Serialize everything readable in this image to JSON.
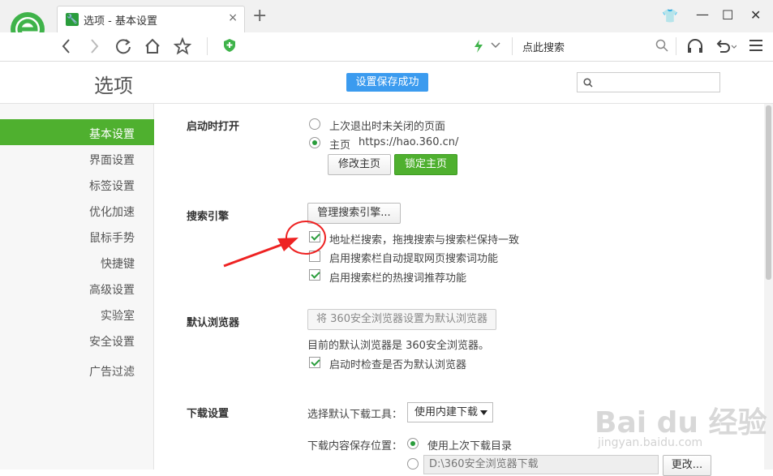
{
  "tab": {
    "title": "选项 - 基本设置",
    "close": "×",
    "new_tab": "+"
  },
  "window_controls": {
    "skin": "👕",
    "minimize": "—",
    "maximize": "☐",
    "close": "✕"
  },
  "address_bar": {
    "search_placeholder": "点此搜索"
  },
  "header": {
    "title": "选项",
    "toast": "设置保存成功"
  },
  "sidebar": {
    "items": [
      {
        "label": "基本设置"
      },
      {
        "label": "界面设置"
      },
      {
        "label": "标签设置"
      },
      {
        "label": "优化加速"
      },
      {
        "label": "鼠标手势"
      },
      {
        "label": "快捷键"
      },
      {
        "label": "高级设置"
      },
      {
        "label": "实验室"
      },
      {
        "label": "安全设置"
      },
      {
        "label": "广告过滤"
      }
    ]
  },
  "startup": {
    "heading": "启动时打开",
    "option_last": "上次退出时未关闭的页面",
    "option_home": "主页",
    "home_url": "https://hao.360.cn/",
    "edit_home_btn": "修改主页",
    "lock_home_btn": "锁定主页"
  },
  "search_engine": {
    "heading": "搜索引擎",
    "manage_btn": "管理搜索引擎...",
    "opt_address_sync": "地址栏搜索，拖拽搜索与搜索栏保持一致",
    "opt_auto_extract": "启用搜索栏自动提取网页搜索词功能",
    "opt_hot_words": "启用搜索栏的热搜词推荐功能"
  },
  "default_browser": {
    "heading": "默认浏览器",
    "set_default_btn": "将 360安全浏览器设置为默认浏览器",
    "status": "目前的默认浏览器是 360安全浏览器。",
    "opt_check": "启动时检查是否为默认浏览器"
  },
  "download": {
    "heading": "下载设置",
    "tool_label": "选择默认下载工具：",
    "tool_value": "使用内建下载",
    "location_label": "下载内容保存位置：",
    "opt_last_dir": "使用上次下载目录",
    "path_value": "D:\\360安全浏览器下载",
    "change_btn": "更改..."
  },
  "watermark": {
    "brand": "Bai du 经验",
    "url": "jingyan.baidu.com"
  },
  "colors": {
    "accent_green": "#4fb02f",
    "toast_blue": "#3b9bef",
    "annotation_red": "#e22222"
  },
  "icons": [
    "browser-logo-icon",
    "wrench-icon",
    "back-icon",
    "forward-icon",
    "refresh-icon",
    "home-icon",
    "star-icon",
    "shield-icon",
    "lightning-icon",
    "search-icon",
    "headphones-icon",
    "undo-icon",
    "menu-icon"
  ]
}
